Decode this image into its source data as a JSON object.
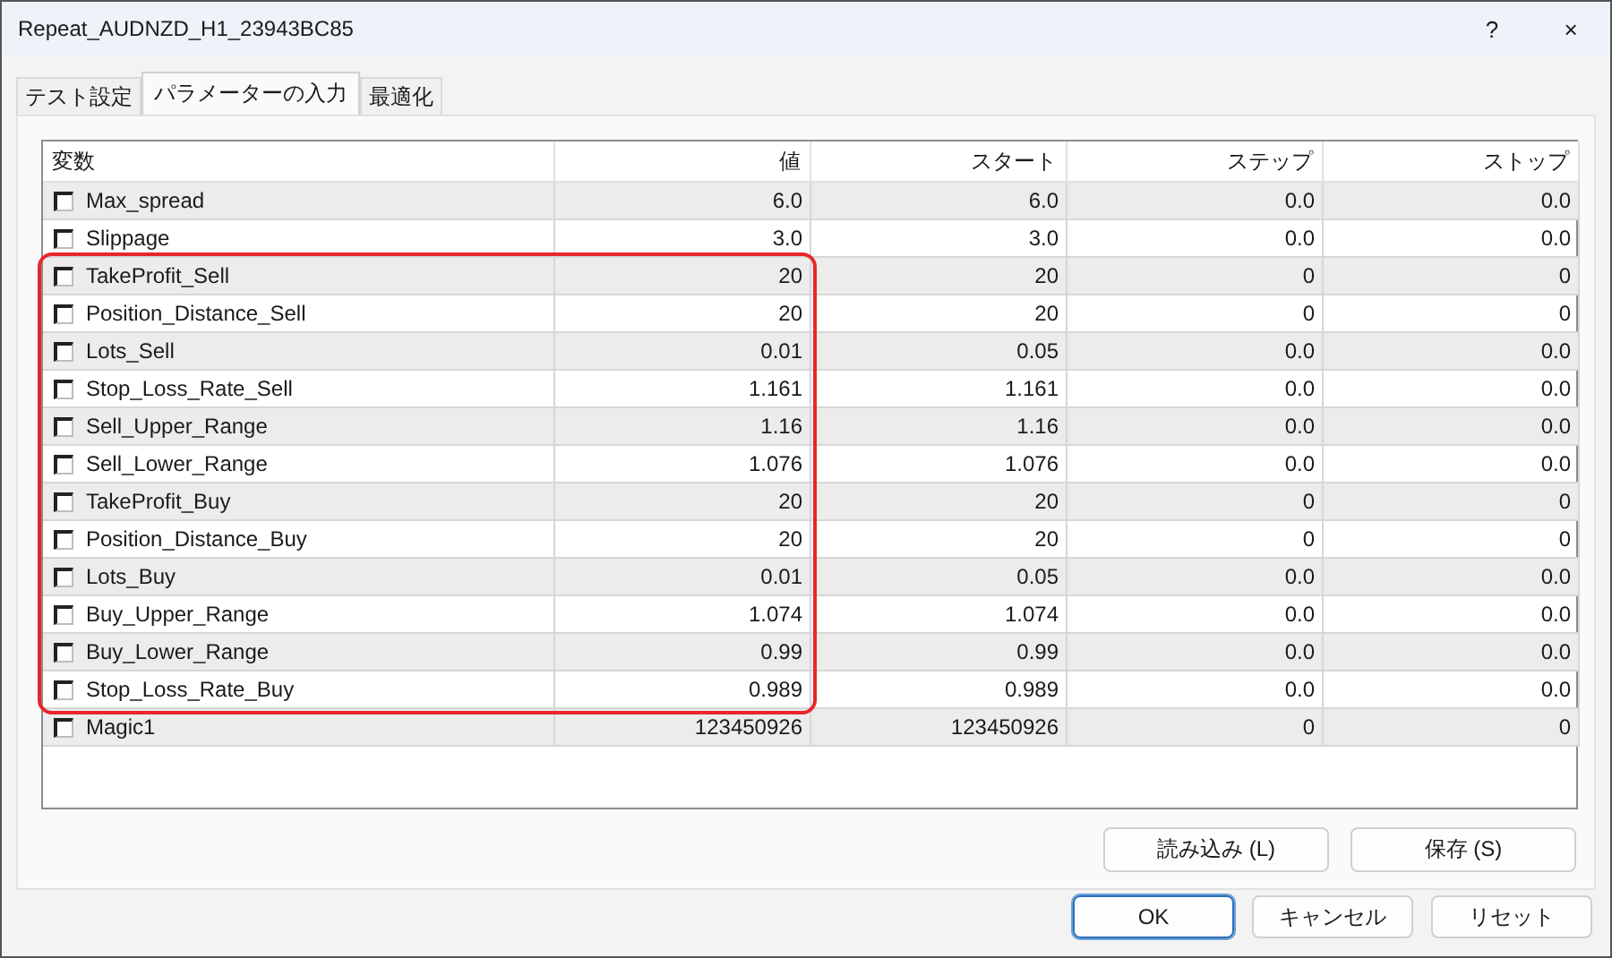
{
  "window": {
    "title": "Repeat_AUDNZD_H1_23943BC85",
    "help": "?",
    "close": "×"
  },
  "tabs": [
    {
      "label": "テスト設定",
      "selected": false
    },
    {
      "label": "パラメーターの入力",
      "selected": true
    },
    {
      "label": "最適化",
      "selected": false
    }
  ],
  "table": {
    "columns": [
      "変数",
      "値",
      "スタート",
      "ステップ",
      "ストップ"
    ],
    "row_groups": [
      {
        "highlighted": false,
        "rows": [
          {
            "name": "Max_spread",
            "checked": false,
            "values": [
              "6.0",
              "6.0",
              "0.0",
              "0.0"
            ]
          },
          {
            "name": "Slippage",
            "checked": false,
            "values": [
              "3.0",
              "3.0",
              "0.0",
              "0.0"
            ]
          }
        ]
      },
      {
        "highlighted": true,
        "rows": [
          {
            "name": "TakeProfit_Sell",
            "checked": false,
            "values": [
              "20",
              "20",
              "0",
              "0"
            ]
          },
          {
            "name": "Position_Distance_Sell",
            "checked": false,
            "values": [
              "20",
              "20",
              "0",
              "0"
            ]
          },
          {
            "name": "Lots_Sell",
            "checked": false,
            "values": [
              "0.01",
              "0.05",
              "0.0",
              "0.0"
            ]
          },
          {
            "name": "Stop_Loss_Rate_Sell",
            "checked": false,
            "values": [
              "1.161",
              "1.161",
              "0.0",
              "0.0"
            ]
          },
          {
            "name": "Sell_Upper_Range",
            "checked": false,
            "values": [
              "1.16",
              "1.16",
              "0.0",
              "0.0"
            ]
          },
          {
            "name": "Sell_Lower_Range",
            "checked": false,
            "values": [
              "1.076",
              "1.076",
              "0.0",
              "0.0"
            ]
          },
          {
            "name": "TakeProfit_Buy",
            "checked": false,
            "values": [
              "20",
              "20",
              "0",
              "0"
            ]
          },
          {
            "name": "Position_Distance_Buy",
            "checked": false,
            "values": [
              "20",
              "20",
              "0",
              "0"
            ]
          },
          {
            "name": "Lots_Buy",
            "checked": false,
            "values": [
              "0.01",
              "0.05",
              "0.0",
              "0.0"
            ]
          },
          {
            "name": "Buy_Upper_Range",
            "checked": false,
            "values": [
              "1.074",
              "1.074",
              "0.0",
              "0.0"
            ]
          },
          {
            "name": "Buy_Lower_Range",
            "checked": false,
            "values": [
              "0.99",
              "0.99",
              "0.0",
              "0.0"
            ]
          },
          {
            "name": "Stop_Loss_Rate_Buy",
            "checked": false,
            "values": [
              "0.989",
              "0.989",
              "0.0",
              "0.0"
            ]
          }
        ]
      },
      {
        "highlighted": false,
        "rows": [
          {
            "name": "Magic1",
            "checked": false,
            "values": [
              "123450926",
              "123450926",
              "0",
              "0"
            ]
          }
        ]
      }
    ]
  },
  "panel_buttons": [
    "読み込み (L)",
    "保存 (S)"
  ],
  "dialog_buttons": [
    {
      "label": "OK",
      "default": true
    },
    {
      "label": "キャンセル",
      "default": false
    },
    {
      "label": "リセット",
      "default": false
    }
  ]
}
